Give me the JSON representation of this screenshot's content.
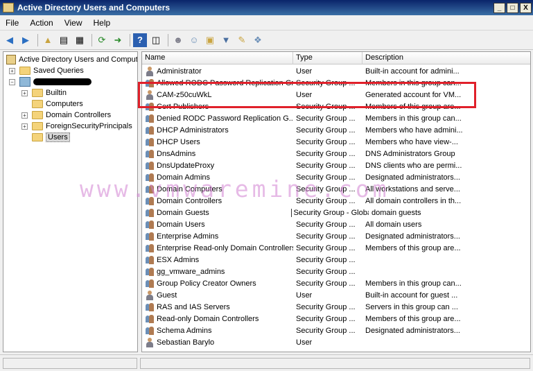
{
  "window": {
    "title": "Active Directory Users and Computers",
    "minimize": "_",
    "maximize": "□",
    "close": "X"
  },
  "menu": [
    "File",
    "Action",
    "View",
    "Help"
  ],
  "toolbar": {
    "icons": [
      "back-icon",
      "forward-icon",
      "up-folder-icon",
      "console-tree-icon",
      "properties-icon",
      "refresh-icon",
      "export-list-icon",
      "help-icon",
      "show-pane-icon",
      "new-user-icon",
      "new-group-icon",
      "new-ou-icon",
      "filter-icon",
      "find-icon",
      "add-to-group-icon"
    ]
  },
  "tree": {
    "root": "Active Directory Users and Comput",
    "saved_queries": "Saved Queries",
    "children": [
      "Builtin",
      "Computers",
      "Domain Controllers",
      "ForeignSecurityPrincipals",
      "Users"
    ]
  },
  "list": {
    "columns": [
      "Name",
      "Type",
      "Description"
    ],
    "rows": [
      {
        "name": "Administrator",
        "type": "User",
        "desc": "Built-in account for admini...",
        "icon": "user"
      },
      {
        "name": "Allowed RODC Password Replication Group",
        "type": "Security Group ...",
        "desc": "Members in this group can...",
        "icon": "group"
      },
      {
        "name": "CAM-z50cuWkL",
        "type": "User",
        "desc": "Generated account for VM...",
        "icon": "user"
      },
      {
        "name": "Cert Publishers",
        "type": "Security Group ...",
        "desc": "Members of this group are...",
        "icon": "group"
      },
      {
        "name": "Denied RODC Password Replication G...",
        "type": "Security Group ...",
        "desc": "Members in this group can...",
        "icon": "group"
      },
      {
        "name": "DHCP Administrators",
        "type": "Security Group ...",
        "desc": "Members who have admini...",
        "icon": "group"
      },
      {
        "name": "DHCP Users",
        "type": "Security Group ...",
        "desc": "Members who have view-...",
        "icon": "group"
      },
      {
        "name": "DnsAdmins",
        "type": "Security Group ...",
        "desc": "DNS Administrators Group",
        "icon": "group"
      },
      {
        "name": "DnsUpdateProxy",
        "type": "Security Group ...",
        "desc": "DNS clients who are permi...",
        "icon": "group"
      },
      {
        "name": "Domain Admins",
        "type": "Security Group ...",
        "desc": "Designated administrators...",
        "icon": "group"
      },
      {
        "name": "Domain Computers",
        "type": "Security Group ...",
        "desc": "All workstations and serve...",
        "icon": "group"
      },
      {
        "name": "Domain Controllers",
        "type": "Security Group ...",
        "desc": "All domain controllers in th...",
        "icon": "group"
      },
      {
        "name": "Domain Guests",
        "type": "Security Group - Global",
        "desc": "domain guests",
        "icon": "group"
      },
      {
        "name": "Domain Users",
        "type": "Security Group ...",
        "desc": "All domain users",
        "icon": "group"
      },
      {
        "name": "Enterprise Admins",
        "type": "Security Group ...",
        "desc": "Designated administrators...",
        "icon": "group"
      },
      {
        "name": "Enterprise Read-only Domain Controllers",
        "type": "Security Group ...",
        "desc": "Members of this group are...",
        "icon": "group"
      },
      {
        "name": "ESX Admins",
        "type": "Security Group ...",
        "desc": "",
        "icon": "group"
      },
      {
        "name": "gg_vmware_admins",
        "type": "Security Group ...",
        "desc": "",
        "icon": "group"
      },
      {
        "name": "Group Policy Creator Owners",
        "type": "Security Group ...",
        "desc": "Members in this group can...",
        "icon": "group"
      },
      {
        "name": "Guest",
        "type": "User",
        "desc": "Built-in account for guest ...",
        "icon": "user"
      },
      {
        "name": "RAS and IAS Servers",
        "type": "Security Group ...",
        "desc": "Servers in this group can ...",
        "icon": "group"
      },
      {
        "name": "Read-only Domain Controllers",
        "type": "Security Group ...",
        "desc": "Members of this group are...",
        "icon": "group"
      },
      {
        "name": "Schema Admins",
        "type": "Security Group ...",
        "desc": "Designated administrators...",
        "icon": "group"
      },
      {
        "name": "Sebastian Barylo",
        "type": "User",
        "desc": "",
        "icon": "user"
      }
    ]
  },
  "watermark": "www.vmwaremine.com",
  "colors": {
    "highlight": "#e0202a",
    "titlebar": "#0a246a",
    "watermark": "#d282d2"
  }
}
